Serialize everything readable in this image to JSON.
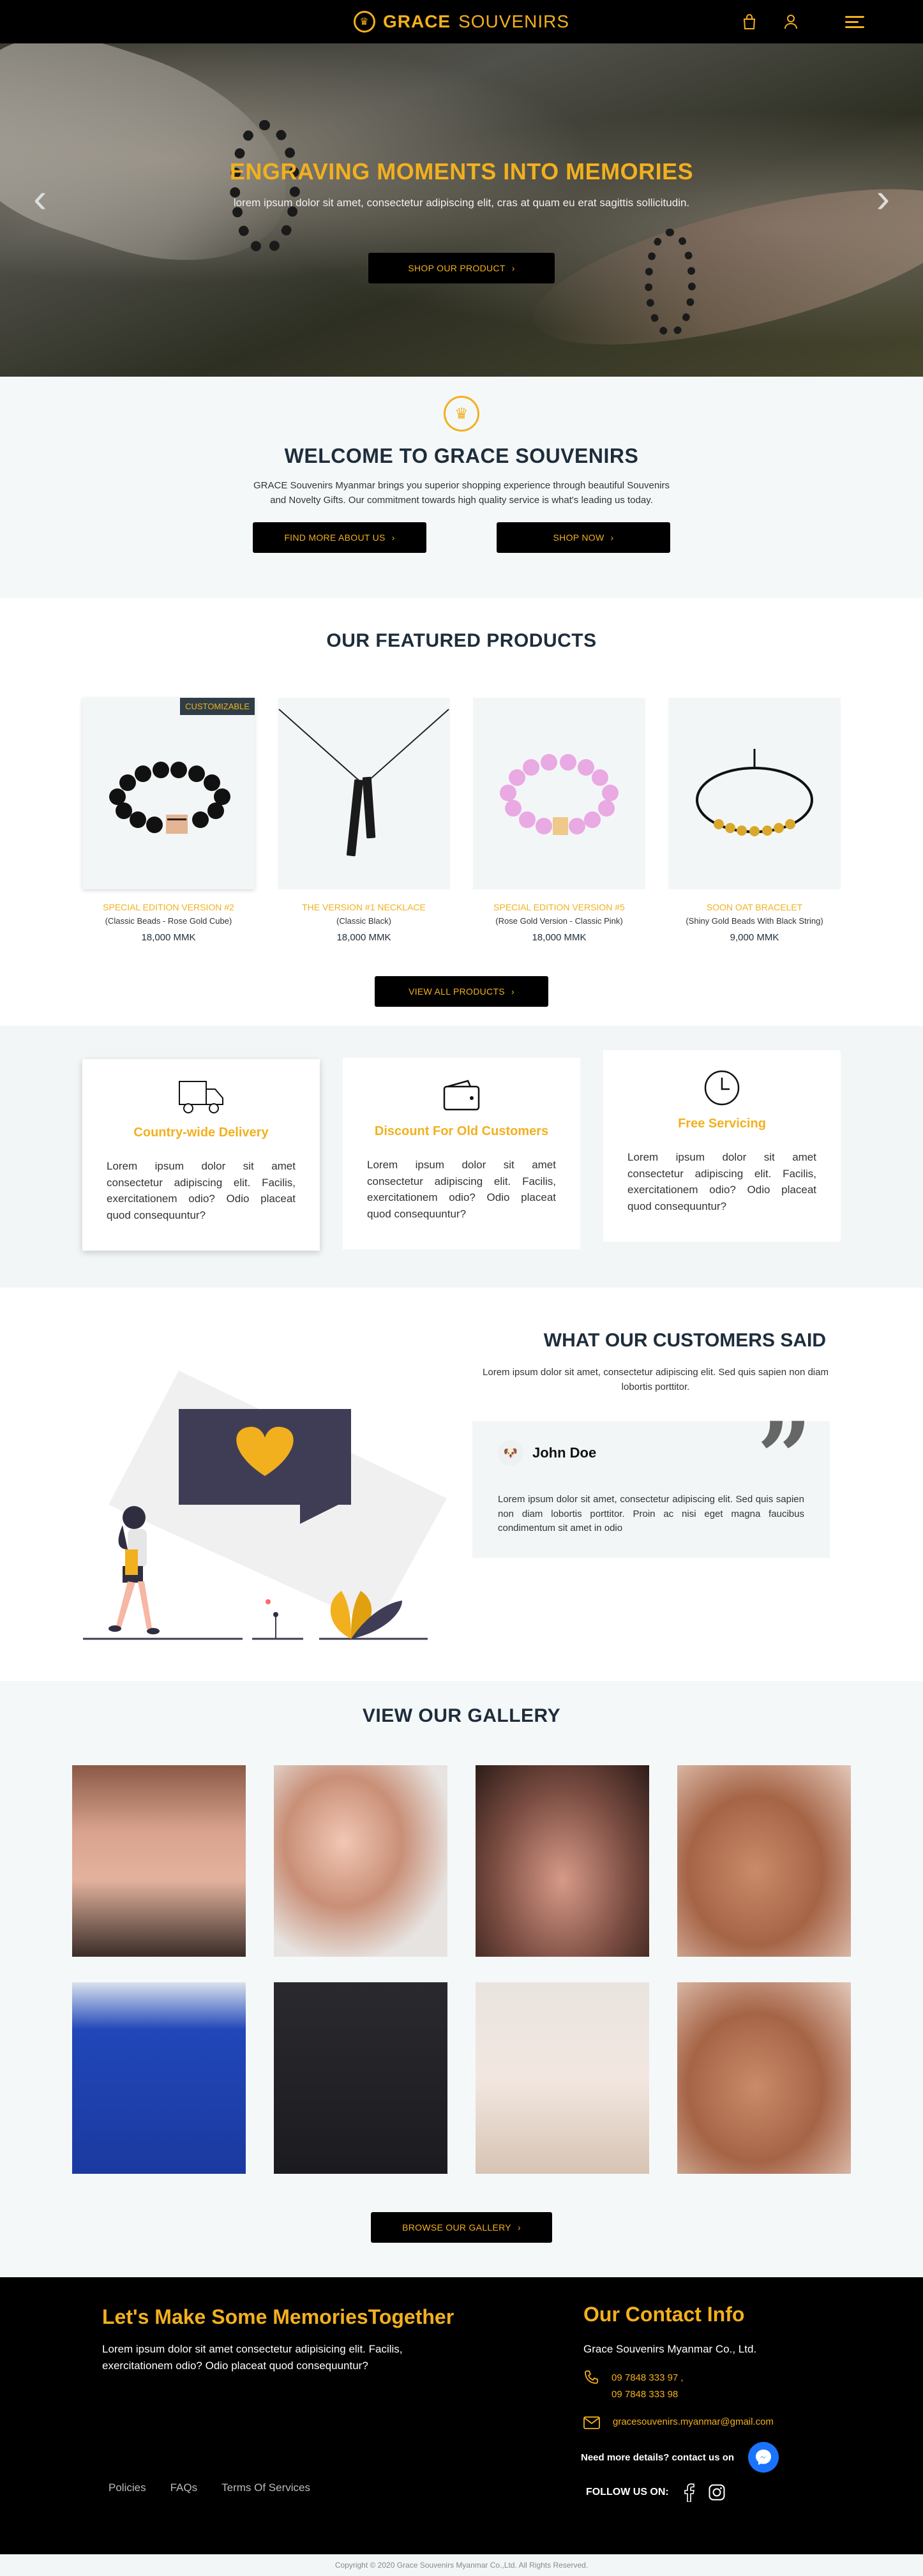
{
  "header": {
    "brand_bold": "GRACE",
    "brand_light": "SOUVENIRS",
    "icons": [
      "bag-icon",
      "user-icon",
      "menu-icon"
    ]
  },
  "hero": {
    "title": "ENGRAVING MOMENTS INTO MEMORIES",
    "subtitle": "lorem ipsum dolor sit amet, consectetur adipiscing elit, cras at quam eu erat sagittis sollicitudin.",
    "cta": "SHOP OUR PRODUCT",
    "prev": "‹",
    "next": "›"
  },
  "welcome": {
    "title_light": "WELCOME TO",
    "title_bold": "GRACE SOUVENIRS",
    "text": "GRACE Souvenirs Myanmar brings you superior shopping experience through beautiful Souvenirs and Novelty Gifts. Our commitment towards high quality service is what's leading us today.",
    "about_btn": "FIND MORE ABOUT US",
    "shop_btn": "SHOP NOW"
  },
  "featured": {
    "title": "OUR FEATURED PRODUCTS",
    "badge": "CUSTOMIZABLE",
    "products": [
      {
        "name": "SPECIAL EDITION VERSION #2",
        "desc": "(Classic Beads - Rose Gold Cube)",
        "price": "18,000 MMK"
      },
      {
        "name": "THE VERSION #1 NECKLACE",
        "desc": "(Classic Black)",
        "price": "18,000 MMK"
      },
      {
        "name": "SPECIAL EDITION VERSION #5",
        "desc": "(Rose Gold Version - Classic Pink)",
        "price": "18,000 MMK"
      },
      {
        "name": "SOON OAT BRACELET",
        "desc": "(Shiny Gold Beads With Black String)",
        "price": "9,000 MMK"
      }
    ],
    "view_all": "VIEW ALL PRODUCTS"
  },
  "features": [
    {
      "icon": "truck-icon",
      "title": "Country-wide Delivery",
      "text": "Lorem ipsum dolor sit amet consectetur adipiscing elit. Facilis, exercitationem odio? Odio placeat quod consequuntur?"
    },
    {
      "icon": "wallet-icon",
      "title": "Discount For Old Customers",
      "text": "Lorem ipsum dolor sit amet consectetur adipiscing elit. Facilis, exercitationem odio? Odio placeat quod consequuntur?"
    },
    {
      "icon": "clock-icon",
      "title": "Free Servicing",
      "text": "Lorem ipsum dolor sit amet consectetur adipiscing elit. Facilis, exercitationem odio? Odio placeat quod consequuntur?"
    }
  ],
  "testimonials": {
    "title": "WHAT OUR CUSTOMERS SAID",
    "subtitle": "Lorem ipsum dolor sit amet, consectetur adipiscing elit. Sed quis sapien non diam lobortis porttitor.",
    "name": "John Doe",
    "text": "Lorem ipsum dolor sit amet, consectetur adipiscing elit. Sed quis sapien non diam lobortis porttitor. Proin ac nisi eget magna faucibus condimentum sit amet in odio"
  },
  "gallery": {
    "title": "VIEW OUR GALLERY",
    "button": "BROWSE OUR GALLERY"
  },
  "footer": {
    "left_title": "Let's Make Some MemoriesTogether",
    "left_text": "Lorem ipsum dolor sit amet consectetur adipisicing elit. Facilis, exercitationem odio? Odio placeat quod consequuntur?",
    "links": [
      "Policies",
      "FAQs",
      "Terms Of Services"
    ],
    "contact_title": "Our Contact Info",
    "company": "Grace Souvenirs Myanmar Co., Ltd.",
    "phone1": "09 7848 333 97 ,",
    "phone2": "09 7848 333 98",
    "email": "gracesouvenirs.myanmar@gmail.com",
    "need_more": "Need more details? contact us on",
    "follow": "FOLLOW US ON:",
    "copyright": "Copyright © 2020 Grace Souvenirs Myanmar Co.,Ltd. All Rights Reserved."
  },
  "colors": {
    "accent": "#f2b01e",
    "dark": "#000000",
    "navy": "#1e2d3b",
    "light_bg": "#f3f6f7"
  }
}
